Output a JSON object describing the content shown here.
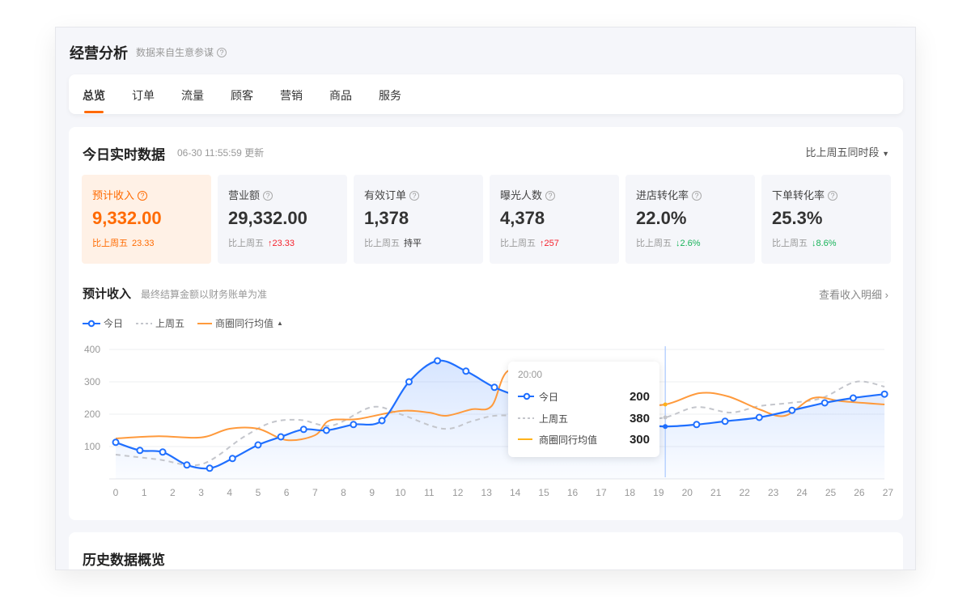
{
  "header": {
    "title": "经营分析",
    "subtitle": "数据来自生意参谋"
  },
  "tabs": [
    {
      "label": "总览",
      "active": true
    },
    {
      "label": "订单"
    },
    {
      "label": "流量"
    },
    {
      "label": "顾客"
    },
    {
      "label": "营销"
    },
    {
      "label": "商品"
    },
    {
      "label": "服务"
    }
  ],
  "realtime": {
    "title": "今日实时数据",
    "updated": "06-30 11:55:59 更新",
    "compare_select": "比上周五同时段"
  },
  "kpis": [
    {
      "label": "预计收入",
      "value": "9,332.00",
      "cmp": "比上周五",
      "delta": "23.33",
      "dir": "none"
    },
    {
      "label": "营业额",
      "value": "29,332.00",
      "cmp": "比上周五",
      "delta": "23.33",
      "dir": "up"
    },
    {
      "label": "有效订单",
      "value": "1,378",
      "cmp": "比上周五",
      "delta": "持平",
      "dir": "flat"
    },
    {
      "label": "曝光人数",
      "value": "4,378",
      "cmp": "比上周五",
      "delta": "257",
      "dir": "up"
    },
    {
      "label": "进店转化率",
      "value": "22.0%",
      "cmp": "比上周五",
      "delta": "2.6%",
      "dir": "down"
    },
    {
      "label": "下单转化率",
      "value": "25.3%",
      "cmp": "比上周五",
      "delta": "8.6%",
      "dir": "down"
    }
  ],
  "income": {
    "title": "预计收入",
    "note": "最终结算金额以财务账单为准",
    "link": "查看收入明细"
  },
  "history": {
    "title": "历史数据概览"
  },
  "colors": {
    "today": "#1f6fff",
    "last_friday": "#c4c6cc",
    "peer_avg": "#ff9a3c",
    "accent": "#ff6a00"
  },
  "chart_data": {
    "type": "line",
    "ylim": [
      0,
      400
    ],
    "yticks": [
      "100",
      "200",
      "300",
      "400"
    ],
    "xticks": [
      "0",
      "1",
      "2",
      "3",
      "4",
      "5",
      "6",
      "7",
      "8",
      "9",
      "10",
      "11",
      "12",
      "13",
      "14",
      "15",
      "16",
      "17",
      "18",
      "19",
      "20",
      "21",
      "22",
      "23",
      "24",
      "25",
      "26",
      "27"
    ],
    "legend": [
      "今日",
      "上周五",
      "商圈同行均值"
    ],
    "series": [
      {
        "name": "今日",
        "points": [
          [
            0,
            113
          ],
          [
            0.85,
            88
          ],
          [
            1.65,
            83
          ],
          [
            2.5,
            43
          ],
          [
            3.3,
            33
          ],
          [
            4.1,
            63
          ],
          [
            5,
            105
          ],
          [
            5.8,
            130
          ],
          [
            6.6,
            153
          ],
          [
            7.4,
            150
          ],
          [
            8.35,
            168
          ],
          [
            9.35,
            180
          ],
          [
            10.3,
            300
          ],
          [
            11.3,
            365
          ],
          [
            12.3,
            333
          ],
          [
            13.3,
            283
          ],
          [
            14.3,
            250
          ],
          [
            15.3,
            220
          ],
          [
            16.3,
            195
          ],
          [
            17.3,
            180
          ],
          [
            18.3,
            170
          ],
          [
            19.3,
            162
          ],
          [
            20.4,
            168
          ],
          [
            21.4,
            178
          ],
          [
            22.6,
            190
          ],
          [
            23.75,
            212
          ],
          [
            24.9,
            235
          ],
          [
            25.9,
            250
          ],
          [
            27,
            262
          ]
        ]
      },
      {
        "name": "上周五",
        "points": [
          [
            0,
            75
          ],
          [
            1.5,
            60
          ],
          [
            3,
            45
          ],
          [
            4.5,
            130
          ],
          [
            5.5,
            175
          ],
          [
            6.5,
            182
          ],
          [
            7.6,
            165
          ],
          [
            9,
            222
          ],
          [
            10,
            200
          ],
          [
            11.5,
            155
          ],
          [
            12.5,
            178
          ],
          [
            13.3,
            195
          ],
          [
            14.3,
            190
          ],
          [
            15.5,
            150
          ],
          [
            17,
            170
          ],
          [
            18.3,
            185
          ],
          [
            19.3,
            190
          ],
          [
            20.4,
            222
          ],
          [
            21.6,
            205
          ],
          [
            22.6,
            225
          ],
          [
            23.7,
            235
          ],
          [
            24.8,
            250
          ],
          [
            26,
            300
          ],
          [
            27,
            285
          ]
        ]
      },
      {
        "name": "商圈同行均值",
        "points": [
          [
            0,
            125
          ],
          [
            1.5,
            132
          ],
          [
            3,
            128
          ],
          [
            4,
            155
          ],
          [
            5,
            155
          ],
          [
            6,
            120
          ],
          [
            7,
            135
          ],
          [
            7.5,
            180
          ],
          [
            8.5,
            185
          ],
          [
            10,
            210
          ],
          [
            11,
            205
          ],
          [
            11.6,
            195
          ],
          [
            12.5,
            215
          ],
          [
            13.2,
            225
          ],
          [
            13.8,
            335
          ],
          [
            15,
            300
          ],
          [
            16.5,
            250
          ],
          [
            18,
            230
          ],
          [
            19.3,
            230
          ],
          [
            20.5,
            265
          ],
          [
            21.5,
            255
          ],
          [
            22.6,
            215
          ],
          [
            23.5,
            195
          ],
          [
            24.5,
            250
          ],
          [
            25.5,
            240
          ],
          [
            27,
            230
          ]
        ]
      }
    ],
    "tooltip": {
      "title": "20:00",
      "rows": [
        {
          "name": "今日",
          "value": "200"
        },
        {
          "name": "上周五",
          "value": "380"
        },
        {
          "name": "商圈同行均值",
          "value": "300"
        }
      ]
    },
    "crosshair_x": 19.3
  }
}
